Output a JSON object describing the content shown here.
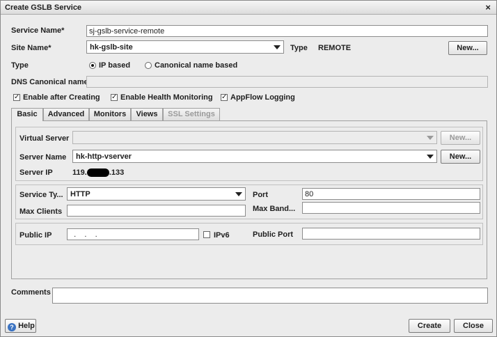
{
  "window": {
    "title": "Create GSLB Service",
    "close_glyph": "×"
  },
  "form": {
    "service_name": {
      "label": "Service Name*",
      "value": "sj-gslb-service-remote"
    },
    "site_name": {
      "label": "Site Name*",
      "value": "hk-gslb-site"
    },
    "type_label": "Type",
    "type_value": "REMOTE",
    "new_button": "New...",
    "type_radio_label": "Type",
    "radio_ip": "IP based",
    "radio_canonical": "Canonical name based",
    "dns_canonical": {
      "label": "DNS Canonical name",
      "value": ""
    },
    "checkboxes": {
      "enable_after": "Enable after Creating",
      "health": "Enable Health Monitoring",
      "appflow": "AppFlow Logging"
    }
  },
  "tabs": [
    "Basic",
    "Advanced",
    "Monitors",
    "Views",
    "SSL Settings"
  ],
  "basic": {
    "virtual_server": {
      "label": "Virtual Server",
      "value": "",
      "new": "New..."
    },
    "server_name": {
      "label": "Server Name",
      "value": "hk-http-vserver",
      "new": "New..."
    },
    "server_ip": {
      "label": "Server IP",
      "prefix": "119.",
      "suffix": ".133"
    },
    "service_type": {
      "label": "Service Ty...",
      "value": "HTTP"
    },
    "port": {
      "label": "Port",
      "value": "80"
    },
    "max_clients": {
      "label": "Max Clients",
      "value": ""
    },
    "max_bandwidth": {
      "label": "Max Band...",
      "value": ""
    },
    "public_ip": {
      "label": "Public IP",
      "value": "  .    .    ."
    },
    "ipv6": "IPv6",
    "public_port": {
      "label": "Public Port",
      "value": ""
    }
  },
  "comments": {
    "label": "Comments",
    "value": ""
  },
  "footer": {
    "help": "Help",
    "create": "Create",
    "close": "Close"
  }
}
